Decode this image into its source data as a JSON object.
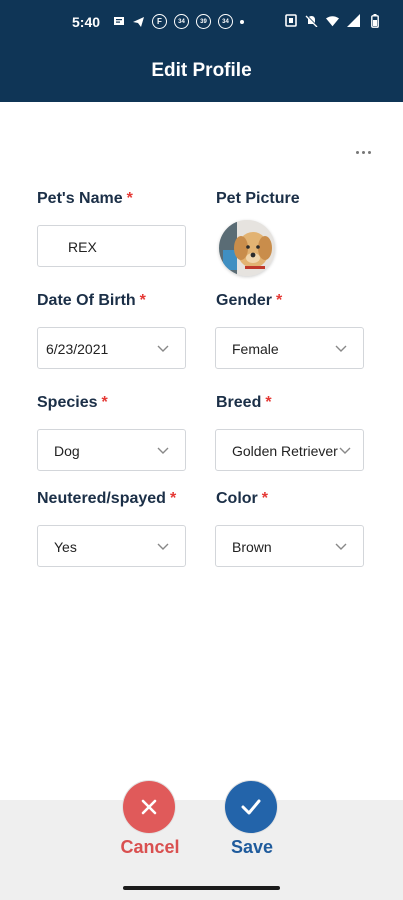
{
  "status_bar": {
    "time": "5:40",
    "badge_1": "34",
    "badge_2": "39",
    "badge_3": "34"
  },
  "header": {
    "title": "Edit Profile"
  },
  "form": {
    "required_mark": "*",
    "pet_name": {
      "label": "Pet's Name",
      "value": "REX"
    },
    "pet_picture": {
      "label": "Pet Picture"
    },
    "dob": {
      "label": "Date Of Birth",
      "value": "6/23/2021"
    },
    "gender": {
      "label": "Gender",
      "value": "Female"
    },
    "species": {
      "label": "Species",
      "value": "Dog"
    },
    "breed": {
      "label": "Breed",
      "value": "Golden Retriever"
    },
    "neutered": {
      "label": "Neutered/spayed",
      "value": "Yes"
    },
    "color": {
      "label": "Color",
      "value": "Brown"
    }
  },
  "actions": {
    "cancel_label": "Cancel",
    "save_label": "Save"
  },
  "colors": {
    "header": "#0f3556",
    "cancel": "#e05a5a",
    "save": "#2364aa",
    "required": "#e53935"
  },
  "icons": [
    "message-icon",
    "send-icon",
    "chevron-down-icon",
    "more-options-icon",
    "close-icon",
    "check-icon"
  ]
}
